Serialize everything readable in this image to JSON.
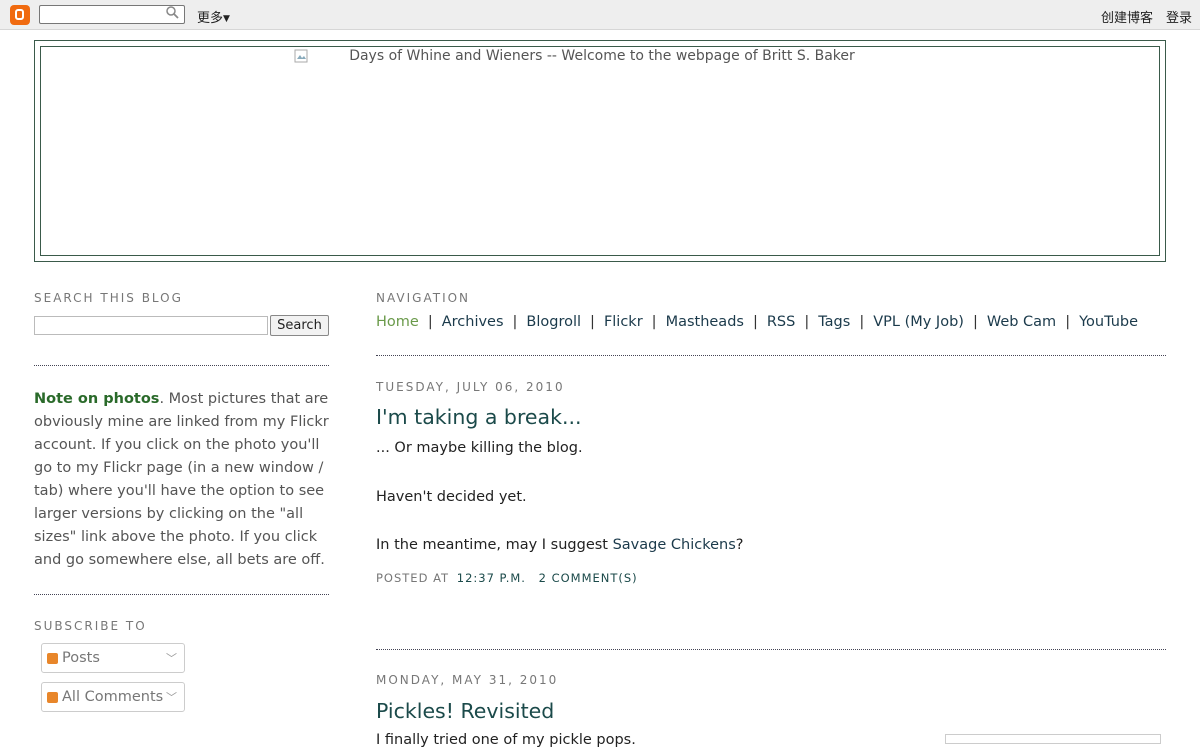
{
  "navbar": {
    "logo_icon": "blogger-icon",
    "search_icon": "magnifier-icon",
    "more_label": "更多",
    "create_blog": "创建博客",
    "sign_in": "登录"
  },
  "header": {
    "alt_text": "Days of Whine and Wieners -- Welcome to the webpage of Britt S. Baker"
  },
  "sidebar": {
    "search_heading": "SEARCH THIS BLOG",
    "search_button": "Search",
    "note_bold": "Note on photos",
    "note_text": ". Most pictures that are obviously mine are linked from my Flickr account. If you click on the photo you'll go to my Flickr page (in a new window / tab) where you'll have the option to see larger versions by clicking on the \"all sizes\" link above the photo. If you click and go somewhere else, all bets are off.",
    "subscribe_heading": "SUBSCRIBE TO",
    "subscribe": [
      {
        "label": "Posts"
      },
      {
        "label": "All Comments"
      }
    ]
  },
  "main": {
    "nav_heading": "NAVIGATION",
    "nav_links": [
      {
        "label": "Home",
        "current": true
      },
      {
        "label": "Archives"
      },
      {
        "label": "Blogroll"
      },
      {
        "label": "Flickr"
      },
      {
        "label": "Mastheads"
      },
      {
        "label": "RSS"
      },
      {
        "label": "Tags"
      },
      {
        "label": "VPL (My Job)"
      },
      {
        "label": "Web Cam"
      },
      {
        "label": "YouTube"
      }
    ],
    "posts": [
      {
        "date": "TUESDAY, JULY 06, 2010",
        "title": "I'm taking a break...",
        "line1": "... Or maybe killing the blog.",
        "line2": "Haven't decided yet.",
        "line3_pre": "In the meantime, may I suggest ",
        "line3_link": "Savage Chickens",
        "line3_post": "?",
        "posted_at_label": "POSTED AT",
        "time": "12:37 P.M.",
        "comments": "2 COMMENT(S)"
      },
      {
        "date": "MONDAY, MAY 31, 2010",
        "title": "Pickles! Revisited",
        "line1": "I finally tried one of my pickle pops."
      }
    ]
  }
}
